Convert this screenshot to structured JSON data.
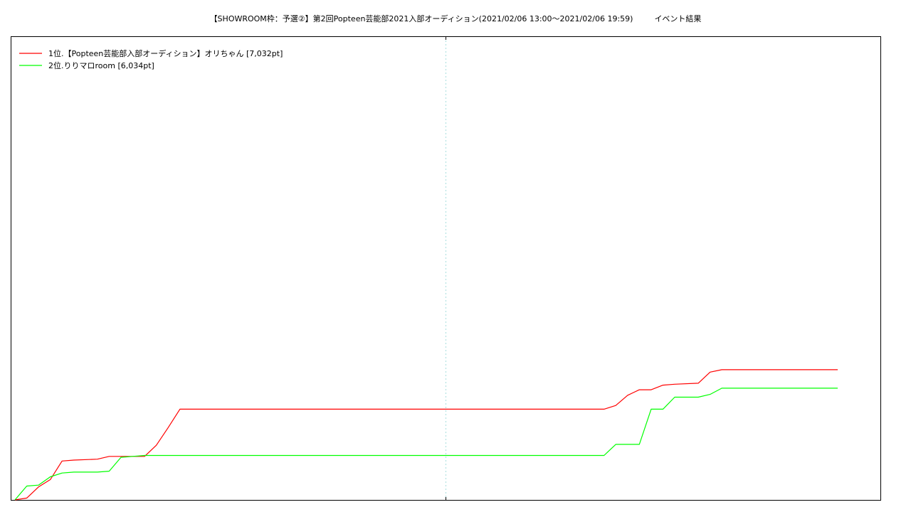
{
  "title": {
    "event": "【SHOWROOM枠：予選②】第2回Popteen芸能部2021入部オーディション(2021/02/06 13:00〜2021/02/06 19:59)",
    "suffix": "イベント結果"
  },
  "chart_data": {
    "type": "line",
    "title": "【SHOWROOM枠：予選②】第2回Popteen芸能部2021入部オーディション(2021/02/06 13:00〜2021/02/06 19:59)　イベント結果",
    "xlabel": "",
    "ylabel": "",
    "x_time_range": [
      "2021/02/06 13:00",
      "2021/02/06 19:59"
    ],
    "ylim": [
      0,
      25000
    ],
    "grid": "single vertical dotted line at the midpoint",
    "legend_position": "top-left",
    "series": [
      {
        "name": "1位.【Popteen芸能部入部オーディション】オリちゃん [7,032pt]",
        "color": "#ff0000",
        "points": [
          [
            "13:00",
            0
          ],
          [
            "13:06",
            100
          ],
          [
            "13:12",
            700
          ],
          [
            "13:18",
            1100
          ],
          [
            "13:24",
            2100
          ],
          [
            "13:30",
            2150
          ],
          [
            "13:42",
            2200
          ],
          [
            "13:48",
            2350
          ],
          [
            "14:00",
            2350
          ],
          [
            "14:06",
            2350
          ],
          [
            "14:12",
            2950
          ],
          [
            "14:18",
            3900
          ],
          [
            "14:24",
            4900
          ],
          [
            "14:30",
            4900
          ],
          [
            "15:00",
            4900
          ],
          [
            "16:00",
            4900
          ],
          [
            "17:00",
            4900
          ],
          [
            "18:00",
            4900
          ],
          [
            "18:06",
            5100
          ],
          [
            "18:12",
            5650
          ],
          [
            "18:18",
            5950
          ],
          [
            "18:24",
            5950
          ],
          [
            "18:30",
            6200
          ],
          [
            "18:36",
            6250
          ],
          [
            "18:48",
            6300
          ],
          [
            "18:54",
            6900
          ],
          [
            "19:00",
            7032
          ],
          [
            "19:30",
            7032
          ],
          [
            "19:59",
            7032
          ]
        ]
      },
      {
        "name": "2位.りりマロroom [6,034pt]",
        "color": "#00ff00",
        "points": [
          [
            "13:00",
            0
          ],
          [
            "13:06",
            750
          ],
          [
            "13:12",
            800
          ],
          [
            "13:18",
            1250
          ],
          [
            "13:24",
            1450
          ],
          [
            "13:30",
            1500
          ],
          [
            "13:42",
            1500
          ],
          [
            "13:48",
            1550
          ],
          [
            "13:54",
            2300
          ],
          [
            "14:00",
            2350
          ],
          [
            "14:06",
            2400
          ],
          [
            "14:30",
            2400
          ],
          [
            "15:00",
            2400
          ],
          [
            "16:00",
            2400
          ],
          [
            "17:00",
            2400
          ],
          [
            "18:00",
            2400
          ],
          [
            "18:06",
            3000
          ],
          [
            "18:18",
            3000
          ],
          [
            "18:24",
            4900
          ],
          [
            "18:30",
            4900
          ],
          [
            "18:36",
            5550
          ],
          [
            "18:48",
            5550
          ],
          [
            "18:54",
            5700
          ],
          [
            "19:00",
            6034
          ],
          [
            "19:30",
            6034
          ],
          [
            "19:59",
            6034
          ]
        ]
      }
    ]
  }
}
